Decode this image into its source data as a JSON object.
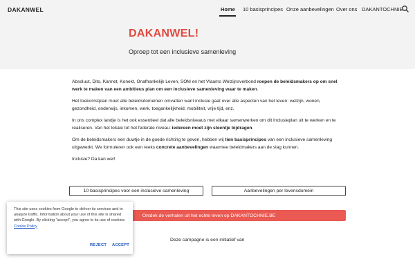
{
  "nav": {
    "brand": "DAKANWEL",
    "items": [
      {
        "label": "Home",
        "active": true
      },
      {
        "label": "10 basisprincipes"
      },
      {
        "label": "Onze aanbevelingen"
      },
      {
        "label": "Over ons"
      },
      {
        "label": "DAKANTOCHNIE"
      }
    ],
    "search_icon": "search-icon"
  },
  "hero": {
    "title": "DAKANWEL!",
    "subtitle": "Oproep tot een inclusieve samenleving",
    "title_color": "#e0493f"
  },
  "content": {
    "p1_a": "Absoluut, Dito, Kannet, Konekt, Onafhankelijk Leven, SOM en het Vlaams Welzijnsverbond ",
    "p1_b": "roepen de beleidsmakers op om snel werk te maken van een ambitieus plan om een inclusieve samenleving waar te maken",
    "p1_c": ".",
    "p2": "Het toekomstplan moet alle beleidsdomeinen omvatten want inclusie gaat over alle aspecten van het leven: welzijn, wonen, gezondheid, onderwijs, inkomen, werk, toegankelijkheid, mobiliteit, vrije tijd, enz.",
    "p3_a": "In ons complex landje is het ook essentieel dat alle beleidsniveaus met elkaar samenwerken om dit Inclusieplan uit te werken en te realiseren. Van het lokale tot het federale niveau: ",
    "p3_b": "iedereen moet zijn steentje bijdragen",
    "p3_c": ".",
    "p4_a": "Om de beleidsmakers een duwtje in de goede richting te geven, hebben wij ",
    "p4_b": "tien basisprincipes",
    "p4_c": " van een inclusieve samenleving uitgewerkt. We formuleren ook een reeks ",
    "p4_d": "concrete aanbevelingen",
    "p4_e": " waarmee beleidmakers aan de slag kunnen.",
    "p5": "Inclusie? Da kan wel!"
  },
  "buttons": {
    "principles": "10 basisprincipes voor een inclusieve samenleving",
    "recommendations": "Aanbevelingen per levensdomein",
    "stories": "Ontdek de verhalen uit het echte leven op DAKANTOCHNIE.BE",
    "stories_color": "#ea5a53"
  },
  "campaign": "Deze campagne is een initiatief van",
  "cookie": {
    "text": "This site uses cookies from Google to deliver its services and to analyze traffic. Information about your use of this site is shared with Google. By clicking \"accept\", you agree to its use of cookies. ",
    "link": "Cookie Policy",
    "reject": "REJECT",
    "accept": "ACCEPT",
    "accent": "#1a56c4"
  }
}
